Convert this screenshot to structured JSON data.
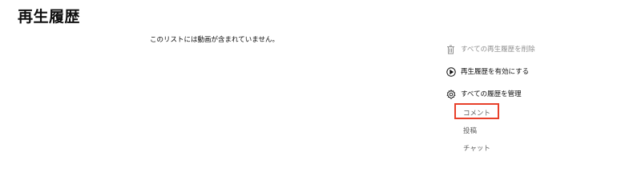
{
  "page": {
    "title": "再生履歴",
    "empty_message": "このリストには動画が含まれていません。"
  },
  "side_panel": {
    "actions": [
      {
        "label": "すべての再生履歴を削除",
        "icon": "trash-icon",
        "enabled": false
      },
      {
        "label": "再生履歴を有効にする",
        "icon": "play-circle-icon",
        "enabled": true
      },
      {
        "label": "すべての履歴を管理",
        "icon": "gear-icon",
        "enabled": true
      }
    ],
    "sub_items": [
      {
        "label": "コメント",
        "highlighted": true
      },
      {
        "label": "投稿",
        "highlighted": false
      },
      {
        "label": "チャット",
        "highlighted": false
      }
    ]
  },
  "colors": {
    "highlight_border": "#e8402a",
    "disabled_text": "#909090",
    "sub_item_text": "#606060",
    "primary_text": "#0f0f0f"
  }
}
